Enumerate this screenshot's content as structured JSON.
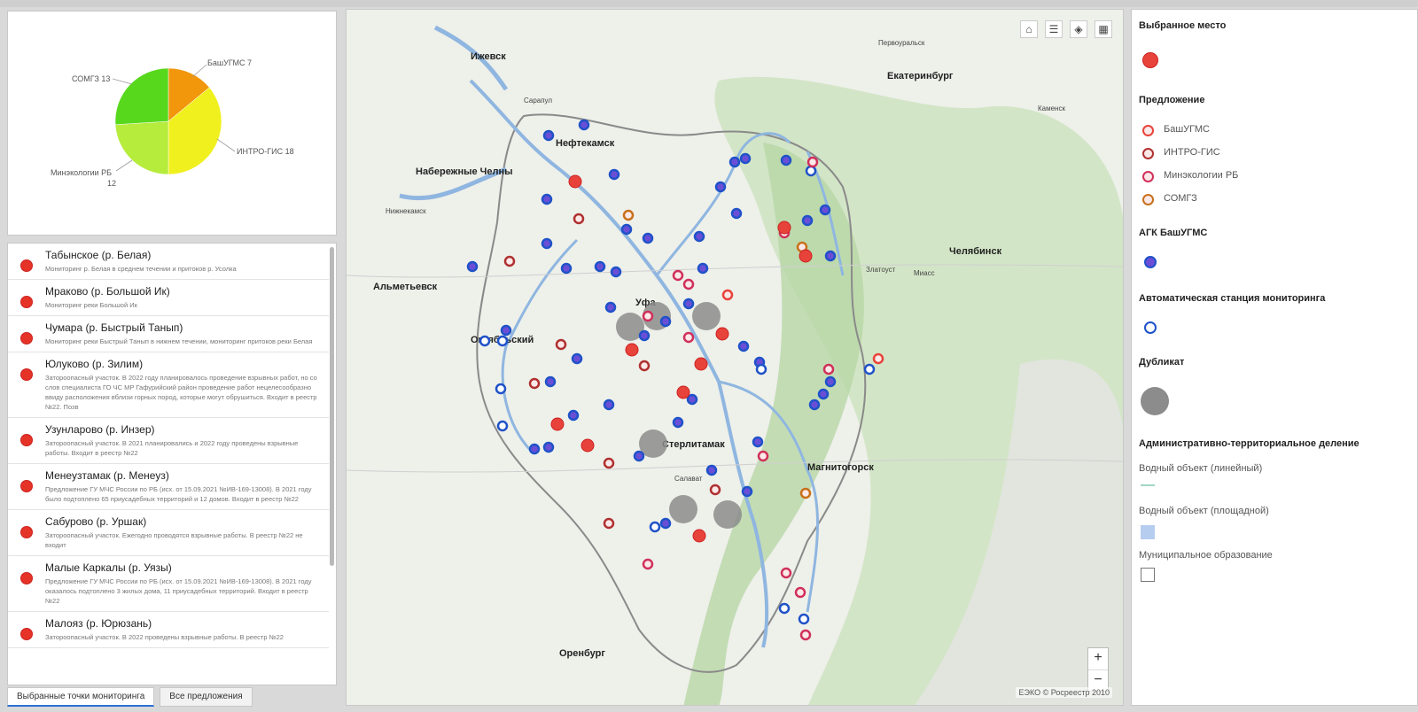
{
  "chart_data": {
    "type": "pie",
    "slices": [
      {
        "label": "БашУГМС",
        "value": 7,
        "color": "#f2960c"
      },
      {
        "label": "ИНТРО-ГИС",
        "value": 18,
        "color": "#f0f01e"
      },
      {
        "label": "Минэкологии РБ",
        "value": 12,
        "color": "#b6ec3c"
      },
      {
        "label": "СОМГЗ",
        "value": 13,
        "color": "#58d81d"
      }
    ],
    "slice_labels": [
      "БашУГМС 7",
      "ИНТРО-ГИС 18",
      "Минэкологии РБ",
      "12",
      "СОМГЗ 13"
    ]
  },
  "list": {
    "items": [
      {
        "title": "Табынское (р. Белая)",
        "desc": "Мониторинг р. Белая в среднем течении и притоков р. Усолка"
      },
      {
        "title": "Мраково (р. Большой Ик)",
        "desc": "Мониторинг реки Большой Ик"
      },
      {
        "title": "Чумара (р. Быстрый Танып)",
        "desc": "Мониторинг реки Быстрый Танып в нижнем течении, мониторинг притоков реки Белая"
      },
      {
        "title": "Юлуково (р. Зилим)",
        "desc": "Заторoопасный участок. В 2022 году планировалось проведение взрывных работ, но со слов специалиста ГО ЧС МР Гафурийский район проведение работ нецелесообразно ввиду расположения вблизи горных пород, которые могут обрушиться. Входит в реестр №22. Позв"
      },
      {
        "title": "Узунларово (р. Инзер)",
        "desc": "Заторoопасный участок. В 2021 планировались и 2022 году проведены взрывные работы. Входит в реестр №22"
      },
      {
        "title": "Менеузтамак (р. Менеуз)",
        "desc": "Предложение ГУ МЧС России по РБ (исх. от 15.09.2021 №ИВ-169-13008). В 2021 году было подтоплено 65 приусадебных территорий и 12 домов. Входит в реестр №22"
      },
      {
        "title": "Сабурово (р. Уршак)",
        "desc": "Заторoопасный участок. Ежегодно проводятся взрывные работы. В реестр №22 не входит"
      },
      {
        "title": "Малые Каркалы (р. Уязы)",
        "desc": "Предложение ГУ МЧС России по РБ (исх. от 15.09.2021 №ИВ-169-13008). В 2021 году оказалось подтоплено 3 жилых дома, 11 приусадебных территорий. Входит в реестр №22"
      },
      {
        "title": "Малояз (р. Юрюзань)",
        "desc": "Заторoопасный участок. В 2022 проведены взрывные работы. В реестр №22"
      }
    ]
  },
  "tabs": {
    "selected": "Выбранные точки мониторинга",
    "all": "Все предложения"
  },
  "map": {
    "tools": [
      "home-icon",
      "list-icon",
      "layers-icon",
      "grid-icon"
    ],
    "zoom_in": "+",
    "zoom_out": "−",
    "attribution": "ЕЭКО © Росреестр 2010",
    "cities": [
      "Ижевск",
      "Сарапул",
      "Нефтекамск",
      "Набережные Челны",
      "Нижнекамск",
      "Альметьевск",
      "Октябрьский",
      "Уфа",
      "Стерлитамак",
      "Салават",
      "Магнитогорск",
      "Оренбург",
      "Екатеринбург",
      "Челябинск",
      "Миасс",
      "Златоуст",
      "Первоуральск",
      "Каменск"
    ]
  },
  "legend": {
    "selected_title": "Выбранное место",
    "proposal_title": "Предложение",
    "proposals": [
      {
        "label": "БашУГМС",
        "color": "#e8433a"
      },
      {
        "label": "ИНТРО-ГИС",
        "color": "#b03030"
      },
      {
        "label": "Минэкологии РБ",
        "color": "#d0305a"
      },
      {
        "label": "СОМГЗ",
        "color": "#c8701a"
      }
    ],
    "agk_title": "АГК БашУГМС",
    "auto_title": "Автоматическая станция мониторинга",
    "dup_title": "Дубликат",
    "admin_title": "Административно-территориальное деление",
    "water_linear": "Водный объект (линейный)",
    "water_area": "Водный объект (площадной)",
    "municipal": "Муниципальное образование"
  }
}
